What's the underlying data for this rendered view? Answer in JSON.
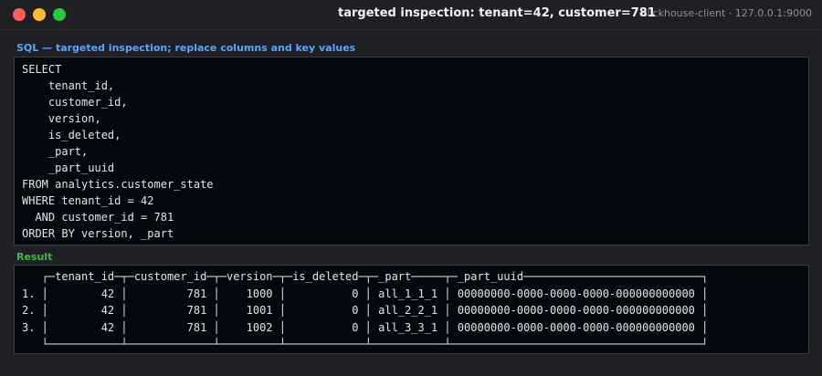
{
  "window": {
    "title": "targeted inspection: tenant=42, customer=781",
    "subtitle": "clickhouse-client · 127.0.0.1:9000"
  },
  "sql_section": {
    "label": "SQL — targeted inspection; replace columns and key values",
    "query": "SELECT\n    tenant_id,\n    customer_id,\n    version,\n    is_deleted,\n    _part,\n    _part_uuid\nFROM analytics.customer_state\nWHERE tenant_id = 42\n  AND customer_id = 781\nORDER BY version, _part"
  },
  "result_section": {
    "label": "Result",
    "output": "   ┌─tenant_id─┬─customer_id─┬─version─┬─is_deleted─┬─_part─────┬─_part_uuid───────────────────────────┐\n1. │        42 │         781 │    1000 │          0 │ all_1_1_1 │ 00000000-0000-0000-0000-000000000000 │\n2. │        42 │         781 │    1001 │          0 │ all_2_2_1 │ 00000000-0000-0000-0000-000000000000 │\n3. │        42 │         781 │    1002 │          0 │ all_3_3_1 │ 00000000-0000-0000-0000-000000000000 │\n   └───────────┴─────────────┴─────────┴────────────┴───────────┴──────────────────────────────────────┘"
  },
  "colors": {
    "sql_label": "#58a6ff",
    "result_label": "#3fb950",
    "close": "#ff5f57",
    "minimize": "#febc2e",
    "maximize": "#28c840"
  }
}
